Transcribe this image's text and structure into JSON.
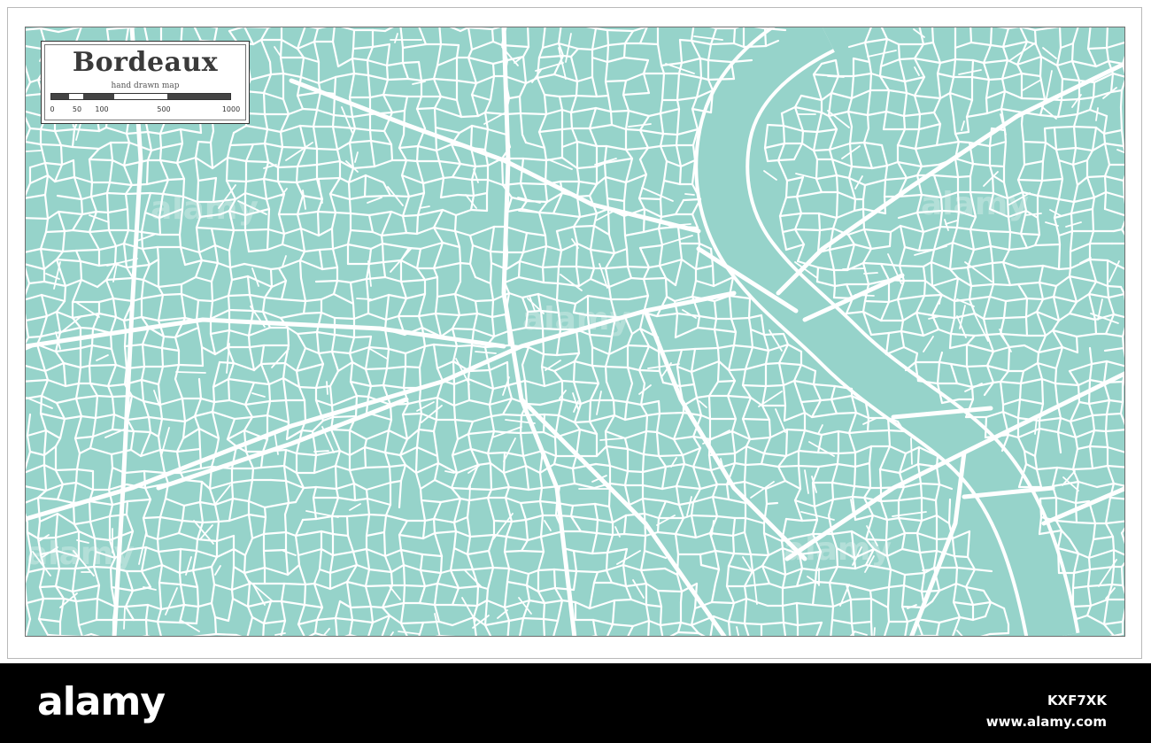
{
  "map": {
    "title": "Bordeaux",
    "subtitle": "hand drawn map",
    "scale_labels": [
      "0",
      "50",
      "100",
      "500",
      "1000"
    ],
    "colors": {
      "land": "#96d3ca",
      "roads": "#ffffff",
      "river": "#96d3ca",
      "frame": "#6f6f6f"
    }
  },
  "watermark": {
    "text": "alamy"
  },
  "footer": {
    "logo": "alamy",
    "image_id": "KXF7XK",
    "url": "www.alamy.com"
  }
}
